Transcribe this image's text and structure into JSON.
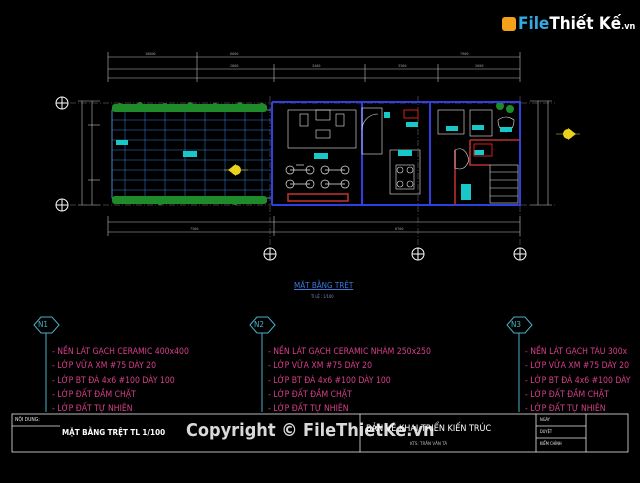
{
  "logo": {
    "brand": "File",
    "brand_rest": "Thiết Kế",
    "tld": ".vn"
  },
  "plan": {
    "title": "MẶT BẰNG TRỆT",
    "scale": "TỈ LỆ : 1/100"
  },
  "notes": [
    {
      "id": "N1",
      "lines": [
        "- NỀN LÁT GẠCH CERAMIC 400x400",
        "- LỚP VỮA XM #75 DÀY 20",
        "- LỚP BT ĐÁ 4x6 #100 DÀY 100",
        "- LỚP ĐẤT ĐẦM CHẶT",
        "- LỚP ĐẤT TỰ NHIÊN"
      ]
    },
    {
      "id": "N2",
      "lines": [
        "- NỀN LÁT GẠCH CERAMIC NHÁM 250x250",
        "- LỚP VỮA XM #75 DÀY 20",
        "- LỚP BT ĐÁ 4x6 #100 DÀY 100",
        "- LỚP ĐẤT ĐẦM CHẶT",
        "- LỚP ĐẤT TỰ NHIÊN"
      ]
    },
    {
      "id": "N3",
      "lines": [
        "- NỀN LÁT GẠCH TÀU 300x",
        "- LỚP VỮA XM #75 DÀY 20",
        "- LỚP BT ĐÁ 4x6 #100 DÀY",
        "- LỚP ĐẤT ĐẦM CHẶT",
        "- LỚP ĐẤT TỰ NHIÊN"
      ]
    }
  ],
  "title_block": {
    "label": "NỘI DUNG:",
    "drawing_name": "MẶT BẰNG TRỆT  TL 1/100",
    "stage": "BẢN VẼ KHAI TRIỂN KIẾN TRÚC",
    "designer": "KTS: TRẦN VĂN TÁ",
    "field_1": "NGÀY",
    "field_2": "DUYỆT",
    "field_3": "KIỂM CHỈNH"
  },
  "watermark": "Copyright © FileThietKe.vn"
}
